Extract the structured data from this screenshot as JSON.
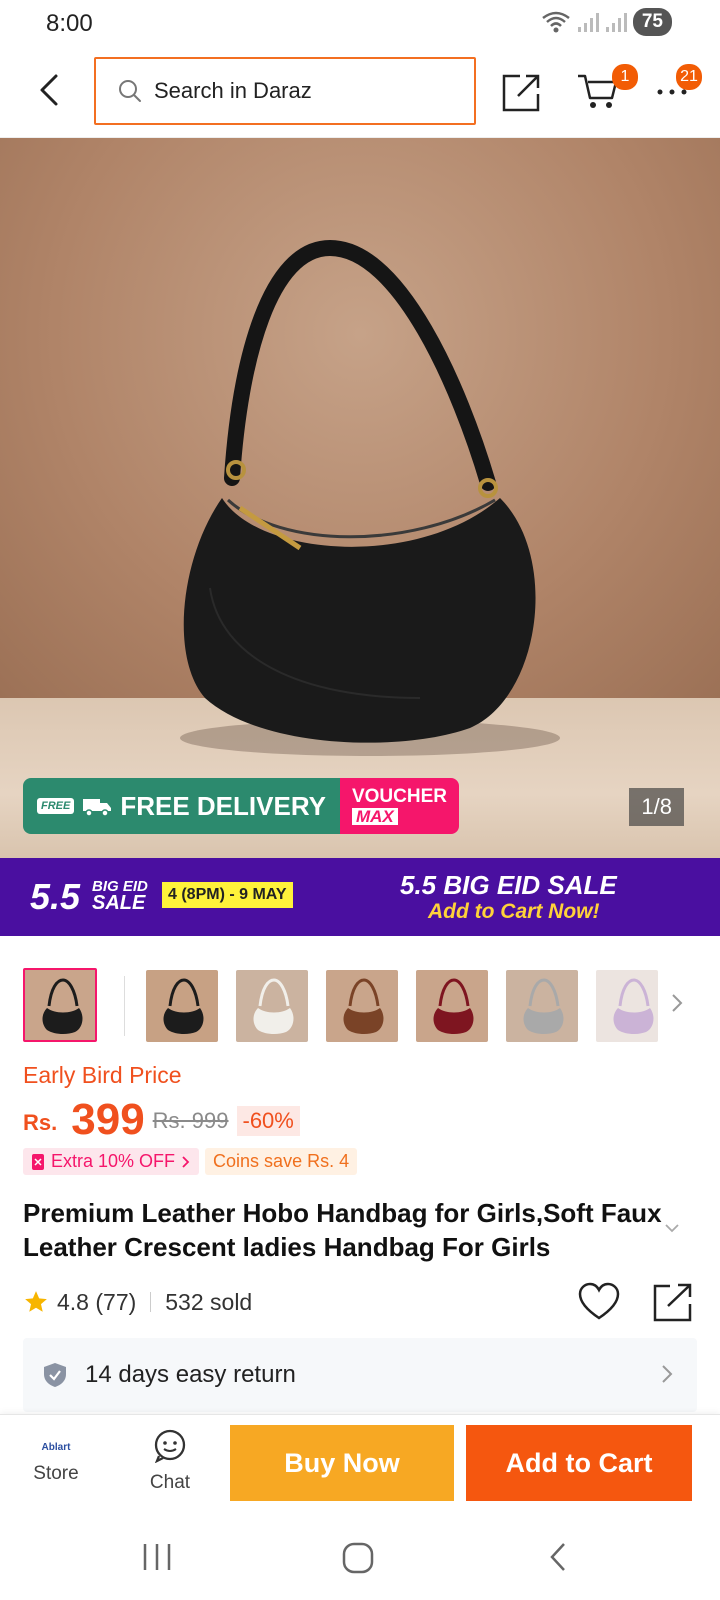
{
  "status_bar": {
    "time": "8:00",
    "battery": "75"
  },
  "header": {
    "search_placeholder": "Search in Daraz",
    "cart_count": "1",
    "more_count": "21"
  },
  "gallery": {
    "counter": "1/8",
    "free_tag": "FREE",
    "free_delivery": "FREE DELIVERY",
    "voucher_line1": "VOUCHER",
    "voucher_line2": "MAX",
    "thumbnails": [
      {
        "color": "#1c1c1c",
        "bg": "#c9a58b"
      },
      {
        "color": "#1c1c1c",
        "bg": "#c7a184"
      },
      {
        "color": "#f1efea",
        "bg": "#cbb3a0"
      },
      {
        "color": "#7a4327",
        "bg": "#c9a58b"
      },
      {
        "color": "#7e1520",
        "bg": "#c9a58b"
      },
      {
        "color": "#a9a9a9",
        "bg": "#cbb3a0"
      },
      {
        "color": "#cbb3d6",
        "bg": "#ece4e0"
      }
    ]
  },
  "sale": {
    "num": "5.5",
    "big_eid": "BIG EID",
    "sale_word": "SALE",
    "dates": "4 (8PM) - 9 MAY",
    "headline": "5.5 BIG EID SALE",
    "cta": "Add to Cart Now!"
  },
  "price": {
    "early_bird": "Early Bird Price",
    "currency": "Rs.",
    "value": "399",
    "original": "Rs. 999",
    "discount": "-60%",
    "extra_tag": "Extra 10% OFF",
    "coins_tag": "Coins save Rs. 4"
  },
  "product": {
    "title": "Premium Leather Hobo Handbag for Girls,Soft Faux Leather Crescent ladies Handbag For Girls",
    "rating": "4.8 (77)",
    "sold": "532 sold"
  },
  "return": {
    "label": "14 days easy return"
  },
  "bottom": {
    "store_logo": "Ablart",
    "store_label": "Store",
    "chat_label": "Chat",
    "buy_now": "Buy Now",
    "add_to_cart": "Add to Cart"
  },
  "colors": {
    "accent": "#f36f21",
    "price": "#f0501e",
    "buy_now": "#f7a823",
    "add_to_cart": "#f5570f",
    "sale_strip": "#4a0fa0",
    "voucher_pink": "#f5166b",
    "delivery_green": "#2c8a6e"
  }
}
